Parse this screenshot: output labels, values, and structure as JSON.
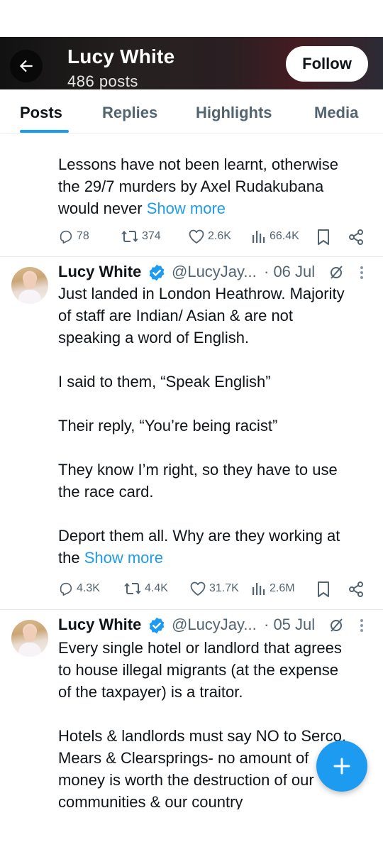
{
  "header": {
    "name": "Lucy White",
    "posts_count": "486 posts",
    "follow_label": "Follow"
  },
  "tabs": [
    "Posts",
    "Replies",
    "Highlights",
    "Media"
  ],
  "active_tab": "Posts",
  "posts": [
    {
      "lines": [
        "Lessons have not been learnt, otherwise",
        "the 29/7 murders by Axel Rudakubana",
        "would never "
      ],
      "show_more": "Show more",
      "stats": {
        "replies": "78",
        "reposts": "374",
        "likes": "2.6K",
        "views": "66.4K"
      }
    },
    {
      "name": "Lucy White",
      "handle": "@LucyJay...",
      "date": "· 06 Jul",
      "lines": [
        "Just landed in London Heathrow. Majority",
        "of staff are Indian/ Asian & are not",
        "speaking a word of English.",
        "",
        "I said to them, “Speak English”",
        "",
        "Their reply, “You’re being racist”",
        "",
        "They know I’m right, so they have to use",
        "the race card.",
        "",
        "Deport them all. Why are they working at",
        "the "
      ],
      "show_more": "Show more",
      "stats": {
        "replies": "4.3K",
        "reposts": "4.4K",
        "likes": "31.7K",
        "views": "2.6M"
      }
    },
    {
      "name": "Lucy White",
      "handle": "@LucyJay...",
      "date": "· 05 Jul",
      "lines": [
        "Every single hotel or landlord that agrees",
        "to house illegal migrants (at the expense",
        "of the taxpayer) is a traitor.",
        "",
        "Hotels & landlords must say NO to Serco,",
        "Mears & Clearsprings- no amount of",
        "money is worth the destruction of our",
        "communities & our country"
      ]
    }
  ],
  "colors": {
    "accent": "#1d9bf0",
    "text": "#0f1419",
    "muted": "#536471",
    "verified": "#1d9bf0"
  },
  "icons": [
    "back-arrow-icon",
    "verified-badge-icon",
    "grok-icon",
    "more-icon",
    "reply-icon",
    "repost-icon",
    "like-icon",
    "views-icon",
    "bookmark-icon",
    "share-icon",
    "plus-icon"
  ]
}
